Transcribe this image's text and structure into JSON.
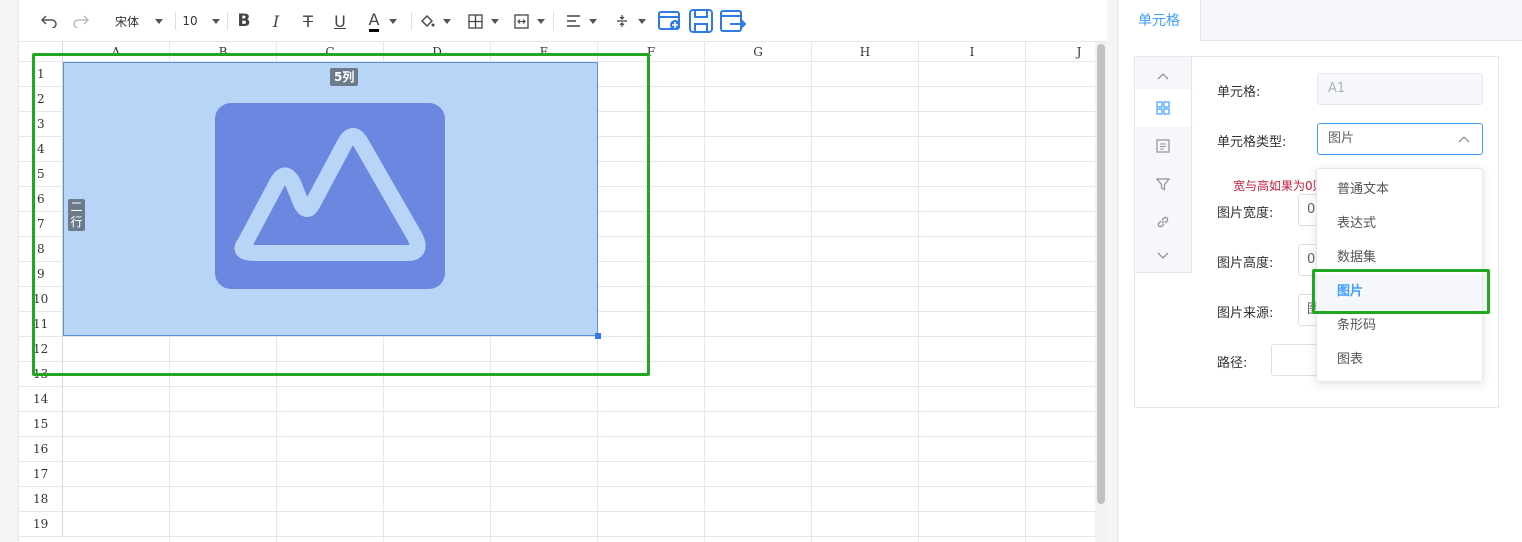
{
  "toolbar": {
    "font_name": "宋体",
    "font_size": "10",
    "bold_label": "B",
    "italic_label": "I",
    "strike_label": "T",
    "underline_label": "U",
    "font_color_label": "A",
    "font_color": "#000000"
  },
  "grid": {
    "columns": [
      "A",
      "B",
      "C",
      "D",
      "E",
      "F",
      "G",
      "H",
      "I",
      "J"
    ],
    "rows": [
      "1",
      "2",
      "3",
      "4",
      "5",
      "6",
      "7",
      "8",
      "9",
      "10",
      "11",
      "12",
      "13",
      "14",
      "15",
      "16",
      "17",
      "18",
      "19"
    ],
    "image_cell": {
      "cols_badge": "5列",
      "rows_badge": "二行",
      "icon": "image-placeholder-icon",
      "fill_color": "#b8d5f7",
      "icon_color": "#6b87e0"
    }
  },
  "panel": {
    "tab_label": "单元格",
    "side_icons": [
      "chevron-up-icon",
      "grid-icon",
      "list-icon",
      "filter-icon",
      "link-icon",
      "chevron-down-icon"
    ],
    "cell_label": "单元格:",
    "cell_value": "A1",
    "type_label": "单元格类型:",
    "type_value": "图片",
    "warning": "宽与高如果为0则",
    "width_label": "图片宽度:",
    "width_value": "0",
    "height_label": "图片高度:",
    "height_value": "0",
    "source_label": "图片来源:",
    "source_value": "图",
    "path_label": "路径:"
  },
  "dropdown": {
    "options": [
      "普通文本",
      "表达式",
      "数据集",
      "图片",
      "条形码",
      "图表"
    ],
    "selected": "图片"
  },
  "highlight_color": "#22a722"
}
